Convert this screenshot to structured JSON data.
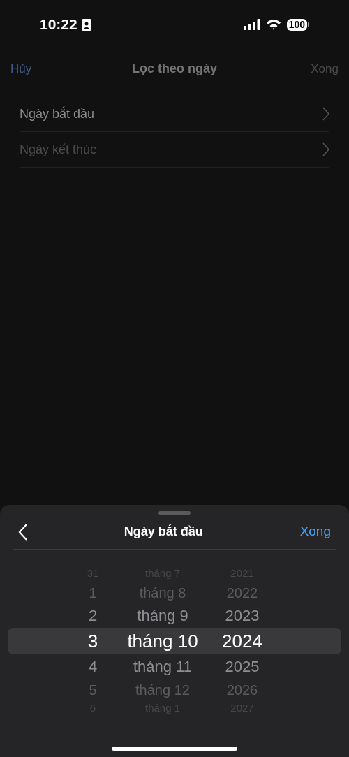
{
  "status_bar": {
    "time": "10:22",
    "battery": "100"
  },
  "nav_bar": {
    "cancel": "Hủy",
    "title": "Lọc theo ngày",
    "done": {
      "label": "Xong",
      "disabled": true
    }
  },
  "list": [
    {
      "label": "Ngày bắt đầu",
      "selected": true
    },
    {
      "label": "Ngày kết thúc",
      "selected": false
    }
  ],
  "sheet": {
    "title": "Ngày bắt đầu",
    "done": "Xong",
    "picker_rows": [
      {
        "day": "31",
        "month": "tháng 7",
        "year": "2021",
        "selected": false
      },
      {
        "day": "1",
        "month": "tháng 8",
        "year": "2022",
        "selected": false
      },
      {
        "day": "2",
        "month": "tháng 9",
        "year": "2023",
        "selected": false
      },
      {
        "day": "3",
        "month": "tháng 10",
        "year": "2024",
        "selected": true
      },
      {
        "day": "4",
        "month": "tháng 11",
        "year": "2025",
        "selected": false
      },
      {
        "day": "5",
        "month": "tháng 12",
        "year": "2026",
        "selected": false
      },
      {
        "day": "6",
        "month": "tháng 1",
        "year": "2027",
        "selected": false
      }
    ]
  }
}
